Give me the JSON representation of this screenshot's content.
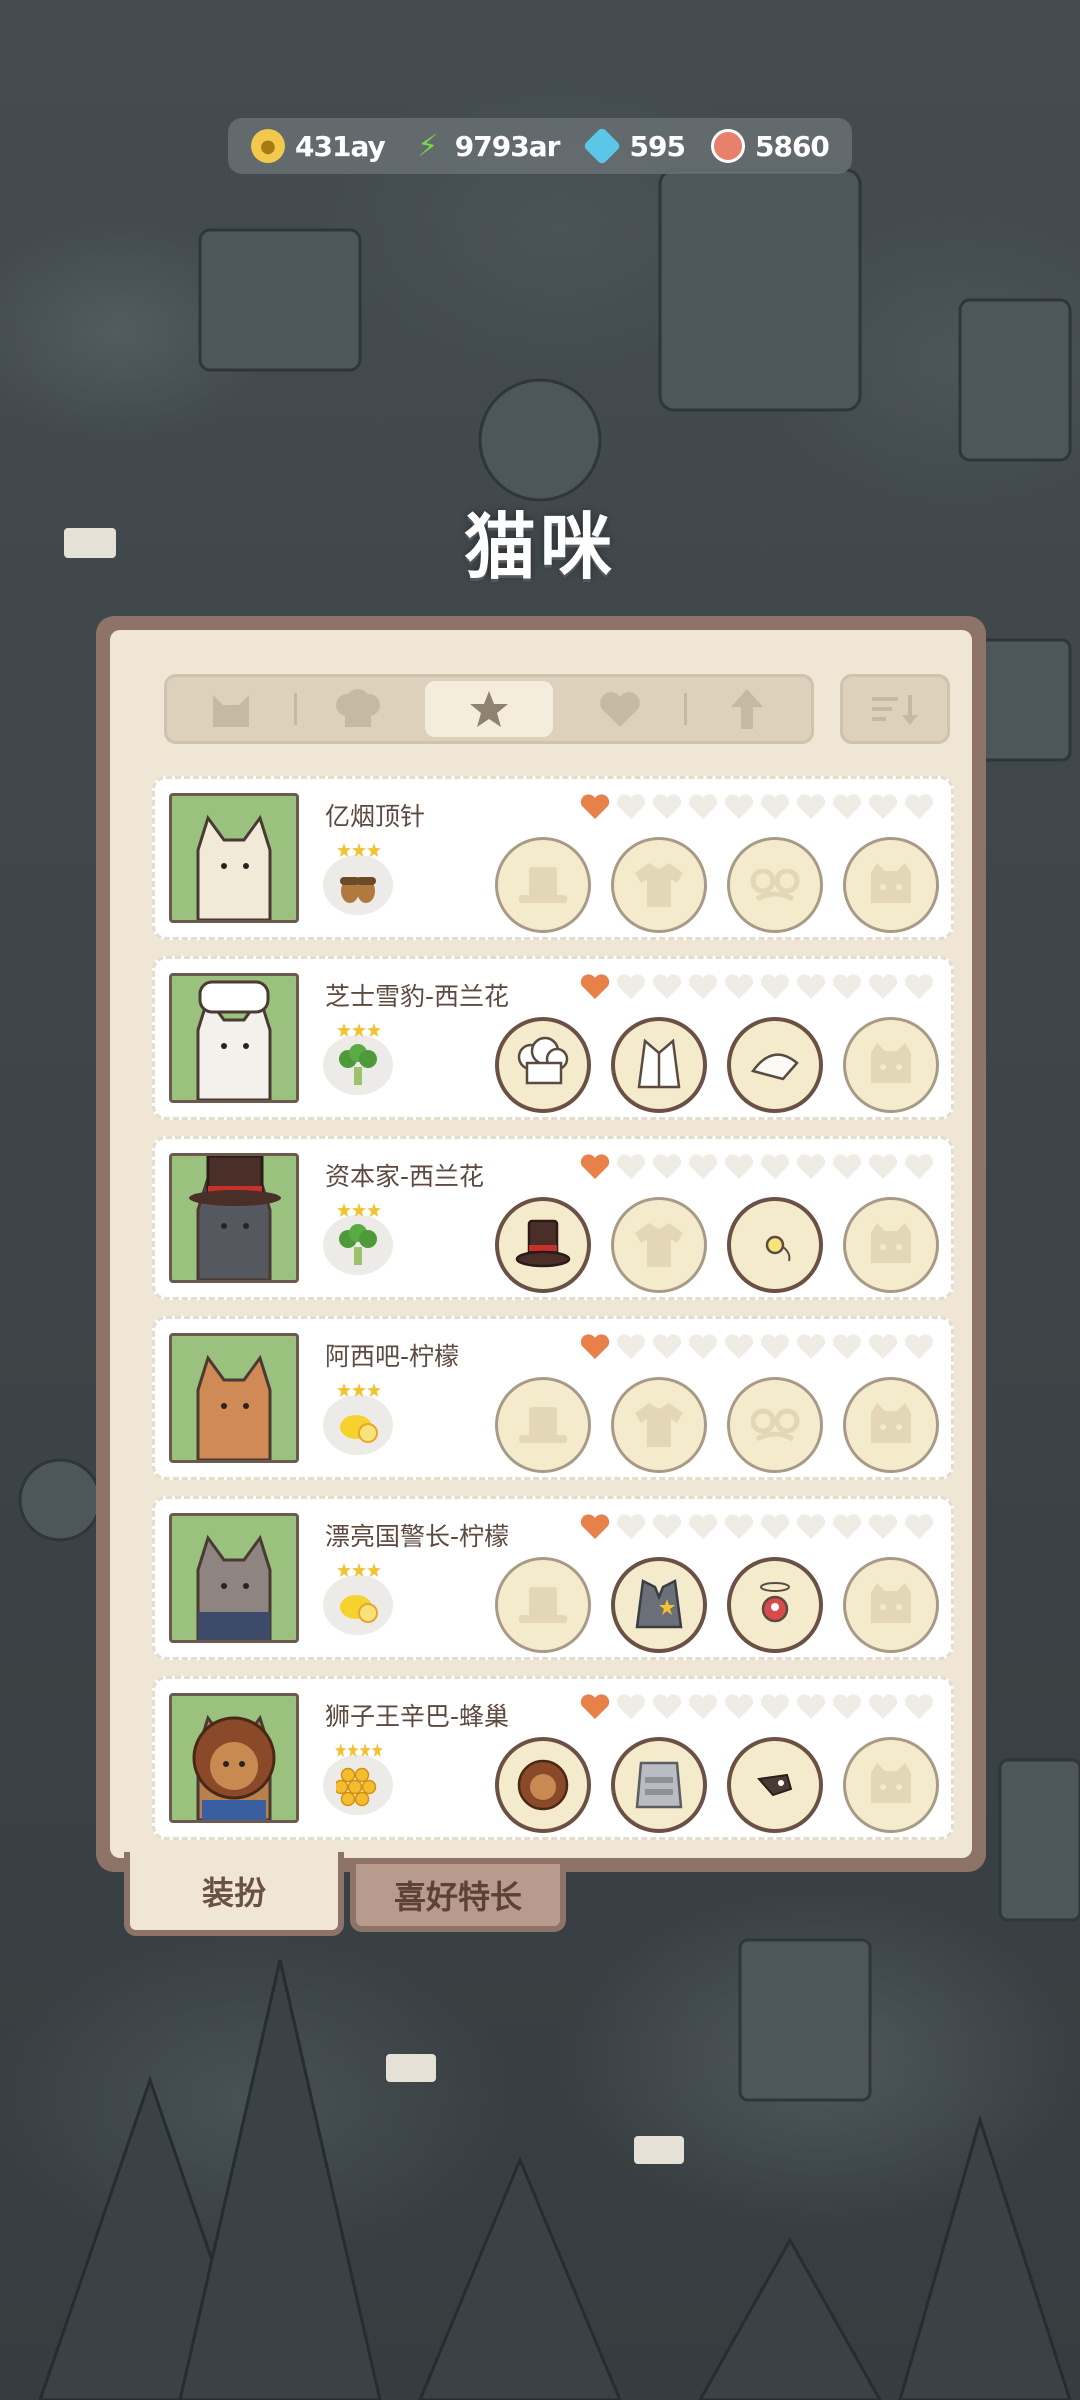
{
  "currency": [
    {
      "icon": "coin-icon",
      "value": "431ay",
      "color": "#f2c94c"
    },
    {
      "icon": "energy-icon",
      "value": "9793ar",
      "color": "#7bd34a"
    },
    {
      "icon": "gem-icon",
      "value": "595",
      "color": "#5cc6e8"
    },
    {
      "icon": "yarn-icon",
      "value": "5860",
      "color": "#e8806b"
    }
  ],
  "page_title": "猫咪",
  "tabs": [
    {
      "icon": "cat-icon",
      "active": false
    },
    {
      "icon": "chef-hat-icon",
      "active": false
    },
    {
      "icon": "star-icon",
      "active": true
    },
    {
      "icon": "heart-icon",
      "active": false
    },
    {
      "icon": "arrow-up-icon",
      "active": false
    }
  ],
  "sort_icon": "sort-icon",
  "cats": [
    {
      "name": "亿烟顶针",
      "food": "acorn",
      "stars": 3,
      "hearts": 1,
      "slots": [
        "hat-empty",
        "shirt-empty",
        "glasses-empty",
        "pet-empty"
      ],
      "fur": "#f1ead8"
    },
    {
      "name": "芝士雪豹-西兰花",
      "food": "broccoli",
      "stars": 3,
      "hearts": 1,
      "slots": [
        "chef-hat",
        "chef-vest",
        "bandana",
        "pet-empty"
      ],
      "fur": "#f3f1ec"
    },
    {
      "name": "资本家-西兰花",
      "food": "broccoli",
      "stars": 3,
      "hearts": 1,
      "slots": [
        "top-hat",
        "shirt-empty",
        "monocle",
        "pet-empty"
      ],
      "fur": "#55585e"
    },
    {
      "name": "阿西吧-柠檬",
      "food": "lemon",
      "stars": 3,
      "hearts": 1,
      "slots": [
        "hat-empty",
        "shirt-empty",
        "glasses-empty",
        "pet-empty"
      ],
      "fur": "#cf8a55"
    },
    {
      "name": "漂亮国警长-柠檬",
      "food": "lemon",
      "stars": 3,
      "hearts": 1,
      "slots": [
        "hat-empty",
        "sheriff-vest",
        "mini-robot",
        "pet-empty"
      ],
      "fur": "#8e8580"
    },
    {
      "name": "狮子王辛巴-蜂巢",
      "food": "honeycomb",
      "stars": 4,
      "hearts": 1,
      "slots": [
        "lion-mane",
        "armor",
        "sunglasses",
        "pet-empty"
      ],
      "fur": "#b8804e"
    }
  ],
  "bottom_tabs": {
    "outfit": "装扮",
    "preferences": "喜好特长"
  }
}
